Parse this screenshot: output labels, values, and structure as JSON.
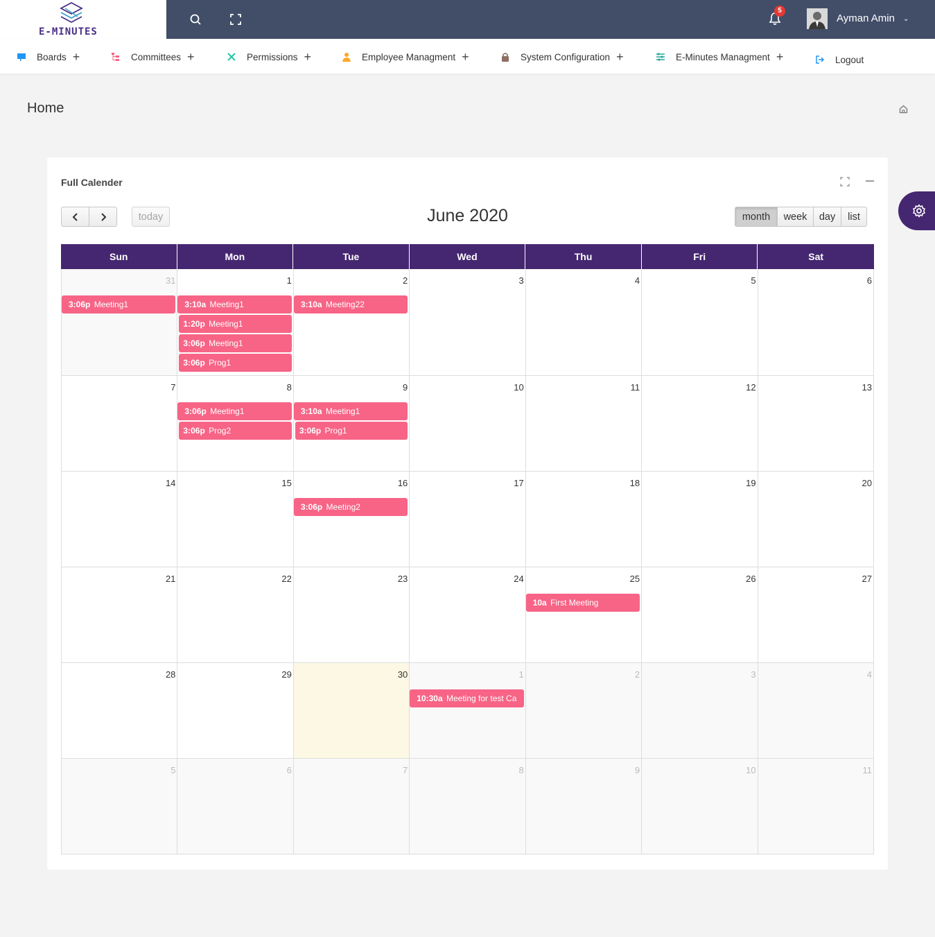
{
  "app": {
    "logo_text": "E-MINUTES"
  },
  "topbar": {
    "notification_count": "5",
    "user_name": "Ayman Amin"
  },
  "nav": [
    {
      "label": "Boards",
      "icon": "boards-icon",
      "color": "#2196f3"
    },
    {
      "label": "Committees",
      "icon": "committees-icon",
      "color": "#f76486"
    },
    {
      "label": "Permissions",
      "icon": "permissions-icon",
      "color": "#26c6a6"
    },
    {
      "label": "Employee Managment",
      "icon": "employee-icon",
      "color": "#ffa726"
    },
    {
      "label": "System Configuration",
      "icon": "lock-icon",
      "color": "#8d6e63"
    },
    {
      "label": "E-Minutes Managment",
      "icon": "sliders-icon",
      "color": "#26a69a"
    },
    {
      "label": "Logout",
      "icon": "logout-icon",
      "color": "#2196f3"
    }
  ],
  "page": {
    "title": "Home"
  },
  "card": {
    "title": "Full Calender",
    "calendar": {
      "title": "June 2020",
      "today_label": "today",
      "views": [
        "month",
        "week",
        "day",
        "list"
      ],
      "active_view": "month",
      "weekdays": [
        "Sun",
        "Mon",
        "Tue",
        "Wed",
        "Thu",
        "Fri",
        "Sat"
      ],
      "colors": {
        "header": "#452771",
        "event": "#f76486",
        "today": "#fcf8e3"
      },
      "weeks": [
        {
          "days": [
            {
              "num": "31",
              "other": true,
              "events": [
                {
                  "time": "3:06p",
                  "title": "Meeting1"
                }
              ]
            },
            {
              "num": "1",
              "other": false,
              "events": [
                {
                  "time": "3:10a",
                  "title": "Meeting1"
                },
                {
                  "time": "1:20p",
                  "title": "Meeting1"
                },
                {
                  "time": "3:06p",
                  "title": "Meeting1"
                },
                {
                  "time": "3:06p",
                  "title": "Prog1"
                }
              ]
            },
            {
              "num": "2",
              "other": false,
              "events": [
                {
                  "time": "3:10a",
                  "title": "Meeting22"
                }
              ]
            },
            {
              "num": "3",
              "other": false,
              "events": []
            },
            {
              "num": "4",
              "other": false,
              "events": []
            },
            {
              "num": "5",
              "other": false,
              "events": []
            },
            {
              "num": "6",
              "other": false,
              "events": []
            }
          ]
        },
        {
          "days": [
            {
              "num": "7",
              "other": false,
              "events": []
            },
            {
              "num": "8",
              "other": false,
              "events": [
                {
                  "time": "3:06p",
                  "title": "Meeting1"
                },
                {
                  "time": "3:06p",
                  "title": "Prog2"
                }
              ]
            },
            {
              "num": "9",
              "other": false,
              "events": [
                {
                  "time": "3:10a",
                  "title": "Meeting1"
                },
                {
                  "time": "3:06p",
                  "title": "Prog1"
                }
              ]
            },
            {
              "num": "10",
              "other": false,
              "events": []
            },
            {
              "num": "11",
              "other": false,
              "events": []
            },
            {
              "num": "12",
              "other": false,
              "events": []
            },
            {
              "num": "13",
              "other": false,
              "events": []
            }
          ]
        },
        {
          "days": [
            {
              "num": "14",
              "other": false,
              "events": []
            },
            {
              "num": "15",
              "other": false,
              "events": []
            },
            {
              "num": "16",
              "other": false,
              "events": [
                {
                  "time": "3:06p",
                  "title": "Meeting2"
                }
              ]
            },
            {
              "num": "17",
              "other": false,
              "events": []
            },
            {
              "num": "18",
              "other": false,
              "events": []
            },
            {
              "num": "19",
              "other": false,
              "events": []
            },
            {
              "num": "20",
              "other": false,
              "events": []
            }
          ]
        },
        {
          "days": [
            {
              "num": "21",
              "other": false,
              "events": []
            },
            {
              "num": "22",
              "other": false,
              "events": []
            },
            {
              "num": "23",
              "other": false,
              "events": []
            },
            {
              "num": "24",
              "other": false,
              "events": []
            },
            {
              "num": "25",
              "other": false,
              "events": [
                {
                  "time": "10a",
                  "title": "First Meeting"
                }
              ]
            },
            {
              "num": "26",
              "other": false,
              "events": []
            },
            {
              "num": "27",
              "other": false,
              "events": []
            }
          ]
        },
        {
          "days": [
            {
              "num": "28",
              "other": false,
              "events": []
            },
            {
              "num": "29",
              "other": false,
              "events": []
            },
            {
              "num": "30",
              "other": false,
              "today": true,
              "events": []
            },
            {
              "num": "1",
              "other": true,
              "events": [
                {
                  "time": "10:30a",
                  "title": "Meeting for test Ca"
                }
              ]
            },
            {
              "num": "2",
              "other": true,
              "events": []
            },
            {
              "num": "3",
              "other": true,
              "events": []
            },
            {
              "num": "4",
              "other": true,
              "events": []
            }
          ]
        },
        {
          "days": [
            {
              "num": "5",
              "other": true,
              "events": []
            },
            {
              "num": "6",
              "other": true,
              "events": []
            },
            {
              "num": "7",
              "other": true,
              "events": []
            },
            {
              "num": "8",
              "other": true,
              "events": []
            },
            {
              "num": "9",
              "other": true,
              "events": []
            },
            {
              "num": "10",
              "other": true,
              "events": []
            },
            {
              "num": "11",
              "other": true,
              "events": []
            }
          ]
        }
      ]
    }
  }
}
